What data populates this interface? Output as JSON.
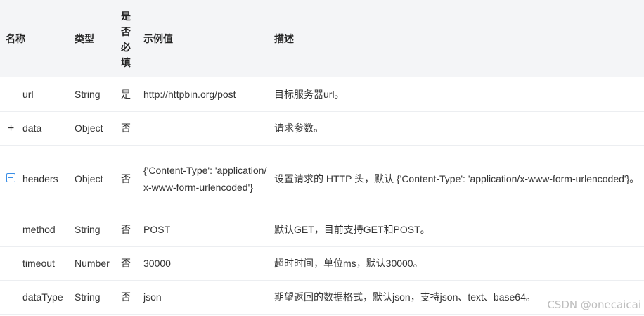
{
  "headers": {
    "name": "名称",
    "type": "类型",
    "required": [
      "是",
      "否",
      "必",
      "填"
    ],
    "example": "示例值",
    "description": "描述"
  },
  "rows": [
    {
      "name": "url",
      "type": "String",
      "required": "是",
      "example": "http://httpbin.org/post",
      "description": "目标服务器url。",
      "expand": "none"
    },
    {
      "name": "data",
      "type": "Object",
      "required": "否",
      "example": "",
      "description": "请求参数。",
      "expand": "plus"
    },
    {
      "name": "headers",
      "type": "Object",
      "required": "否",
      "example": "{'Content-Type': 'application/x-www-form-urlencoded'}",
      "description": "设置请求的 HTTP 头，默认 {'Content-Type': 'application/x-www-form-urlencoded'}。",
      "expand": "boxed-plus"
    },
    {
      "name": "method",
      "type": "String",
      "required": "否",
      "example": "POST",
      "description": "默认GET，目前支持GET和POST。",
      "expand": "none"
    },
    {
      "name": "timeout",
      "type": "Number",
      "required": "否",
      "example": "30000",
      "description": "超时时间，单位ms，默认30000。",
      "expand": "none"
    },
    {
      "name": "dataType",
      "type": "String",
      "required": "否",
      "example": "json",
      "description": "期望返回的数据格式，默认json，支持json、text、base64。",
      "expand": "none"
    }
  ],
  "expand_symbol": "+",
  "watermark": "CSDN @onecaicai"
}
